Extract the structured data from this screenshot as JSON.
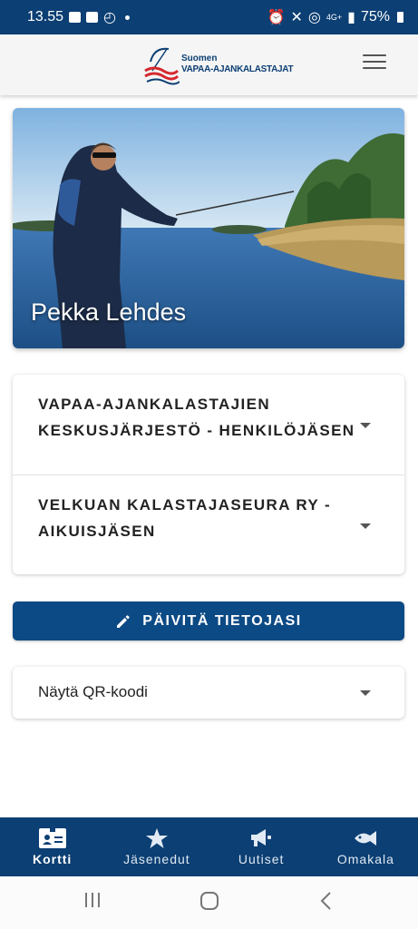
{
  "status_bar": {
    "time": "13.55",
    "network": "4G+",
    "battery": "75%"
  },
  "header": {
    "logo_line1": "Suomen",
    "logo_line2": "VAPAA-AJANKALASTAJAT"
  },
  "profile": {
    "name": "Pekka Lehdes"
  },
  "memberships": [
    {
      "line1": "VAPAA-AJANKALASTAJIEN",
      "line2": "KESKUSJÄRJESTÖ - HENKILÖJÄSEN"
    },
    {
      "line1": "VELKUAN KALASTAJASEURA RY -",
      "line2": "AIKUISJÄSEN"
    }
  ],
  "update_button": {
    "label": "PÄIVITÄ TIETOJASI"
  },
  "qr": {
    "label": "Näytä QR-koodi"
  },
  "bottom_nav": [
    {
      "label": "Kortti",
      "icon": "id-card-icon",
      "active": true
    },
    {
      "label": "Jäsenedut",
      "icon": "star-icon",
      "active": false
    },
    {
      "label": "Uutiset",
      "icon": "megaphone-icon",
      "active": false
    },
    {
      "label": "Omakala",
      "icon": "fish-icon",
      "active": false
    }
  ],
  "colors": {
    "primary": "#0c3f73",
    "button": "#0c4a85"
  }
}
